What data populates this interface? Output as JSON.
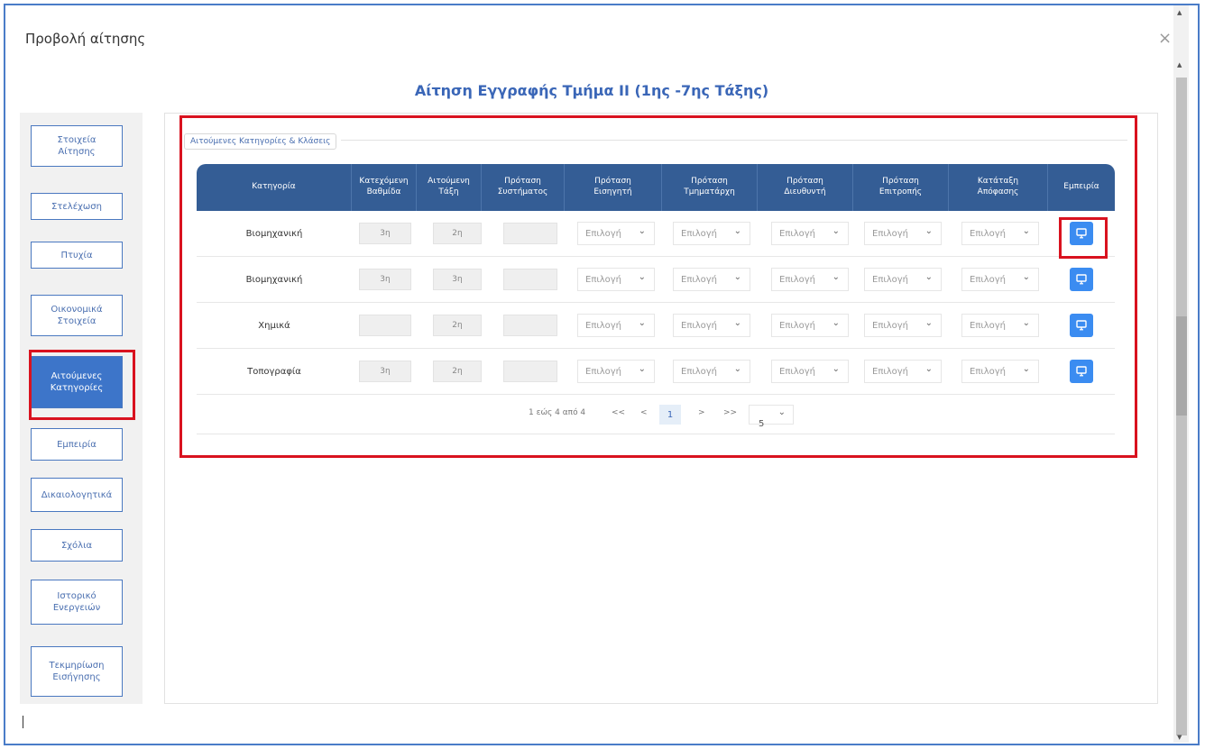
{
  "modal": {
    "title": "Προβολή αίτησης",
    "close": "×"
  },
  "heading": "Αίτηση Εγγραφής Τμήμα ΙΙ (1ης -7ης Τάξης)",
  "sidebar": {
    "items": [
      {
        "label": "Στοιχεία\nΑίτησης"
      },
      {
        "label": "Στελέχωση"
      },
      {
        "label": "Πτυχία"
      },
      {
        "label": "Οικονομικά\nΣτοιχεία"
      },
      {
        "label": "Αιτούμενες\nΚατηγορίες",
        "active": true
      },
      {
        "label": "Εμπειρία"
      },
      {
        "label": "Δικαιολογητικά"
      },
      {
        "label": "Σχόλια"
      },
      {
        "label": "Ιστορικό\nΕνεργειών"
      },
      {
        "label": "Τεκμηρίωση\nΕισήγησης"
      }
    ]
  },
  "section": {
    "legend": "Αιτούμενες Κατηγορίες & Κλάσεις"
  },
  "table": {
    "headers": [
      "Κατηγορία",
      "Κατεχόμενη\nΒαθμίδα",
      "Αιτούμενη\nΤάξη",
      "Πρόταση\nΣυστήματος",
      "Πρόταση\nΕισηγητή",
      "Πρόταση\nΤμηματάρχη",
      "Πρόταση\nΔιευθυντή",
      "Πρόταση\nΕπιτροπής",
      "Κατάταξη\nΑπόφασης",
      "Εμπειρία"
    ],
    "select_placeholder": "Επιλογή",
    "rows": [
      {
        "category": "Βιομηχανική",
        "held": "3η",
        "requested": "2η",
        "system": ""
      },
      {
        "category": "Βιομηχανική",
        "held": "3η",
        "requested": "3η",
        "system": ""
      },
      {
        "category": "Χημικά",
        "held": "",
        "requested": "2η",
        "system": ""
      },
      {
        "category": "Τοπογραφία",
        "held": "3η",
        "requested": "2η",
        "system": ""
      }
    ]
  },
  "pager": {
    "summary": "1 εώς 4 από 4",
    "first": "<<",
    "prev": "<",
    "current": "1",
    "next": ">",
    "last": ">>",
    "page_size": "5"
  },
  "icons": {
    "experience": "monitor-icon",
    "dropdown": "chevron-down-icon"
  },
  "colors": {
    "accent": "#3a66b7",
    "header": "#345d95",
    "highlight": "#d9121f",
    "button": "#3b8cf1"
  }
}
